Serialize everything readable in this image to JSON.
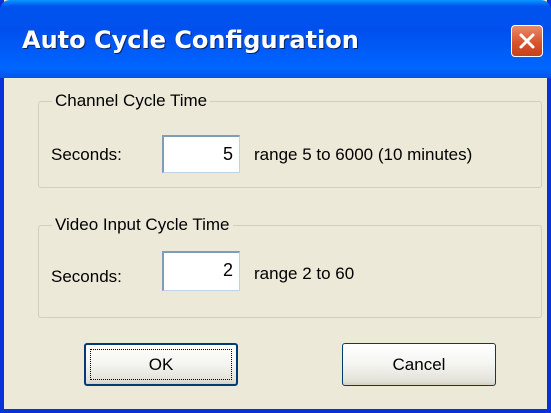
{
  "window": {
    "title": "Auto Cycle Configuration"
  },
  "icons": {
    "close": "close-icon"
  },
  "channel_group": {
    "label": "Channel Cycle Time",
    "seconds_label": "Seconds:",
    "seconds_value": "5",
    "range_text": "range 5 to 6000 (10 minutes)"
  },
  "video_group": {
    "label": "Video Input Cycle Time",
    "seconds_label": "Seconds:",
    "seconds_value": "2",
    "range_text": "range 2 to 60"
  },
  "buttons": {
    "ok_label": "OK",
    "cancel_label": "Cancel"
  },
  "colors": {
    "titlebar": "#0053ee",
    "close_button": "#d9542c",
    "dialog_background": "#ece9d8"
  }
}
